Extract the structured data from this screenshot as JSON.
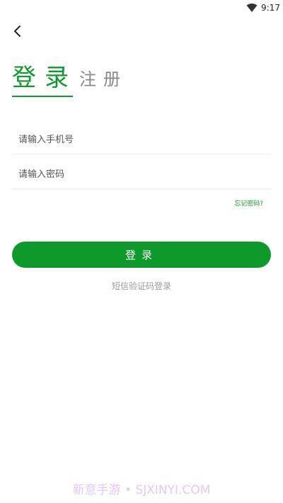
{
  "status_bar": {
    "time": "9:17",
    "wifi_icon": "wifi-icon"
  },
  "header": {
    "back_icon": "chevron-left-icon"
  },
  "tabs": {
    "login_label": "登录",
    "register_label": "注册",
    "active": "login"
  },
  "form": {
    "phone_placeholder": "请输入手机号",
    "phone_value": "",
    "password_placeholder": "请输入密码",
    "password_value": "",
    "forgot_label": "忘记密码?",
    "submit_label": "登录",
    "sms_login_label": "短信验证码登录"
  },
  "watermark": "新意手游 • SJXINYI.COM",
  "colors": {
    "accent": "#0d9a2a",
    "inactive_tab": "#888888",
    "secondary_text": "#999999",
    "watermark": "#e2c8f2"
  }
}
